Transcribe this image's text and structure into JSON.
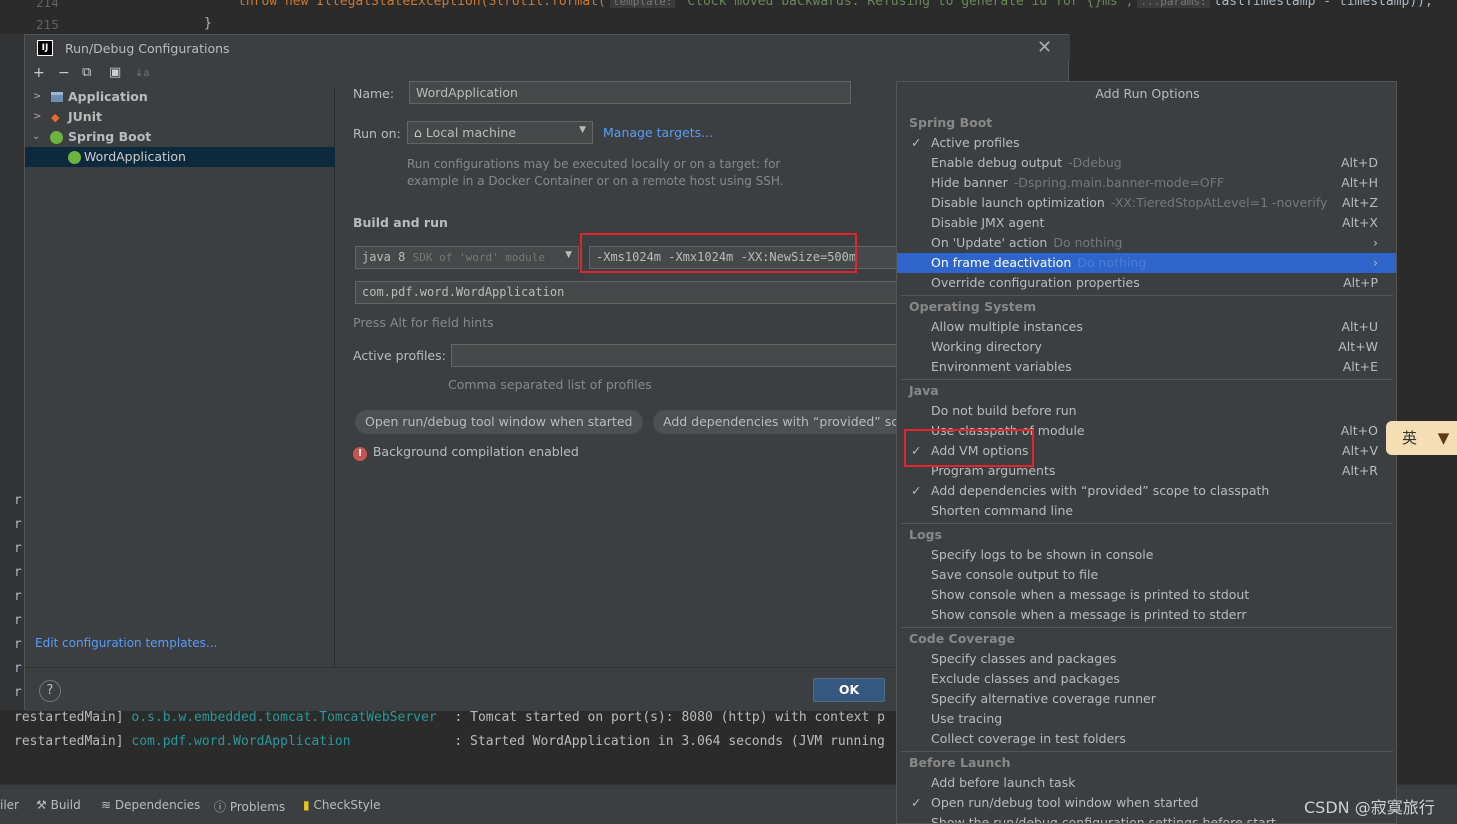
{
  "editor": {
    "line_numbers": [
      "214",
      "215"
    ],
    "code_prefix": "throw new IllegalStateException(StrUtil.format(",
    "hint_template": "template:",
    "code_string": "\"Clock moved backwards. Refusing to generate id for {}ms\",",
    "hint_params": "...params:",
    "code_suffix": "lastTimestamp - timestamp));",
    "brace": "}"
  },
  "dialog": {
    "title": "Run/Debug Configurations",
    "toolbar": [
      "+",
      "−",
      "⧉",
      "▣",
      "↓a"
    ],
    "tree": [
      {
        "label": "Application",
        "icon": "application-icon",
        "expanded": false
      },
      {
        "label": "JUnit",
        "icon": "junit-icon",
        "expanded": false
      },
      {
        "label": "Spring Boot",
        "icon": "spring-boot-icon",
        "expanded": true
      },
      {
        "label": "WordApplication",
        "icon": "spring-boot-icon",
        "selected": true
      }
    ],
    "edit_templates_link": "Edit configuration templates...",
    "name_label": "Name:",
    "name_value": "WordApplication",
    "run_on_label": "Run on:",
    "run_on_value": "Local machine",
    "manage_targets": "Manage targets...",
    "run_on_hint_1": "Run configurations may be executed locally or on a target: for",
    "run_on_hint_2": "example in a Docker Container or on a remote host using SSH.",
    "build_and_run": "Build and run",
    "jdk_value": "java 8",
    "jdk_hint": "SDK of 'word' module",
    "vm_options": "-Xms1024m -Xmx1024m -XX:NewSize=500m",
    "main_class": "com.pdf.word.WordApplication",
    "field_hints": "Press Alt for field hints",
    "active_profiles_label": "Active profiles:",
    "active_profiles_value": "",
    "profiles_hint": "Comma separated list of profiles",
    "chip_1": "Open run/debug tool window when started",
    "chip_2": "Add dependencies with “provided” scope",
    "bg_compilation": "Background compilation enabled",
    "ok": "OK",
    "help": "?"
  },
  "popup": {
    "title": "Add Run Options",
    "sections": [
      {
        "name": "Spring Boot",
        "items": [
          {
            "label": "Active profiles",
            "checked": true,
            "hint": "",
            "shortcut": ""
          },
          {
            "label": "Enable debug output",
            "hint": "-Ddebug",
            "shortcut": "Alt+D"
          },
          {
            "label": "Hide banner",
            "hint": "-Dspring.main.banner-mode=OFF",
            "shortcut": "Alt+H"
          },
          {
            "label": "Disable launch optimization",
            "hint": "-XX:TieredStopAtLevel=1 -noverify",
            "shortcut": "Alt+Z"
          },
          {
            "label": "Disable JMX agent",
            "hint": "",
            "shortcut": "Alt+X"
          },
          {
            "label": "On 'Update' action",
            "hint": "Do nothing",
            "shortcut": "›"
          },
          {
            "label": "On frame deactivation",
            "hint": "Do nothing",
            "shortcut": "›",
            "highlighted": true
          },
          {
            "label": "Override configuration properties",
            "hint": "",
            "shortcut": "Alt+P"
          }
        ]
      },
      {
        "name": "Operating System",
        "items": [
          {
            "label": "Allow multiple instances",
            "hint": "",
            "shortcut": "Alt+U"
          },
          {
            "label": "Working directory",
            "hint": "",
            "shortcut": "Alt+W"
          },
          {
            "label": "Environment variables",
            "hint": "",
            "shortcut": "Alt+E"
          }
        ]
      },
      {
        "name": "Java",
        "items": [
          {
            "label": "Do not build before run",
            "hint": "",
            "shortcut": ""
          },
          {
            "label": "Use classpath of module",
            "hint": "",
            "shortcut": "Alt+O"
          },
          {
            "label": "Add VM options",
            "checked": true,
            "hint": "",
            "shortcut": "Alt+V"
          },
          {
            "label": "Program arguments",
            "hint": "",
            "shortcut": "Alt+R"
          },
          {
            "label": "Add dependencies with “provided” scope to classpath",
            "checked": true,
            "hint": "",
            "shortcut": ""
          },
          {
            "label": "Shorten command line",
            "hint": "",
            "shortcut": ""
          }
        ]
      },
      {
        "name": "Logs",
        "items": [
          {
            "label": "Specify logs to be shown in console",
            "hint": "",
            "shortcut": ""
          },
          {
            "label": "Save console output to file",
            "hint": "",
            "shortcut": ""
          },
          {
            "label": "Show console when a message is printed to stdout",
            "hint": "",
            "shortcut": ""
          },
          {
            "label": "Show console when a message is printed to stderr",
            "hint": "",
            "shortcut": ""
          }
        ]
      },
      {
        "name": "Code Coverage",
        "items": [
          {
            "label": "Specify classes and packages",
            "hint": "",
            "shortcut": ""
          },
          {
            "label": "Exclude classes and packages",
            "hint": "",
            "shortcut": ""
          },
          {
            "label": "Specify alternative coverage runner",
            "hint": "",
            "shortcut": ""
          },
          {
            "label": "Use tracing",
            "hint": "",
            "shortcut": ""
          },
          {
            "label": "Collect coverage in test folders",
            "hint": "",
            "shortcut": ""
          }
        ]
      },
      {
        "name": "Before Launch",
        "items": [
          {
            "label": "Add before launch task",
            "hint": "",
            "shortcut": ""
          },
          {
            "label": "Open run/debug tool window when started",
            "checked": true,
            "hint": "",
            "shortcut": ""
          },
          {
            "label": "Show the run/debug configuration settings before start",
            "hint": "",
            "shortcut": ""
          }
        ]
      }
    ]
  },
  "console": {
    "line1_thread": "restartedMain]",
    "line1_class": "o.s.b.w.embedded.tomcat.TomcatWebServer",
    "line1_msg": ": Tomcat started on port(s): 8080 (http) with context p",
    "line2_thread": "restartedMain]",
    "line2_class": "com.pdf.word.WordApplication",
    "line2_msg": ": Started WordApplication in 3.064 seconds (JVM running"
  },
  "statusbar": {
    "items": [
      "iler",
      "Build",
      "Dependencies",
      "Problems",
      "CheckStyle"
    ]
  },
  "ime": {
    "label": "英"
  },
  "watermark": "CSDN @寂寞旅行"
}
